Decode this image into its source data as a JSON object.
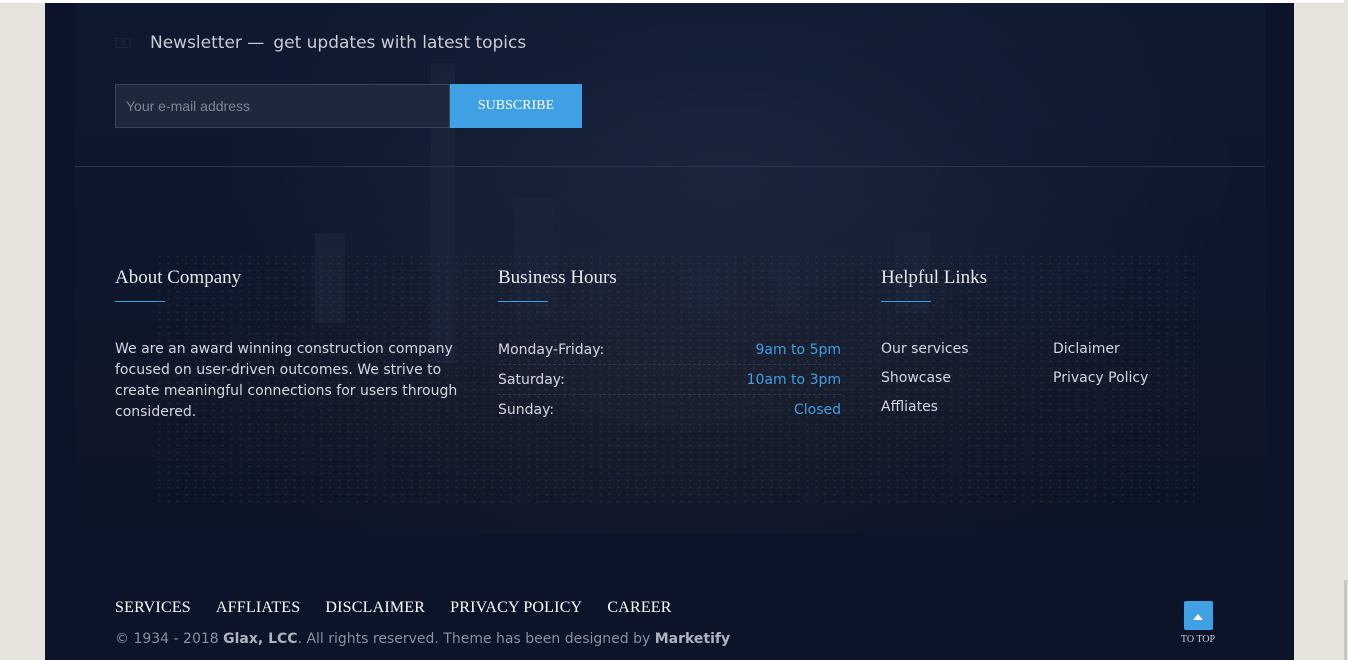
{
  "newsletter": {
    "title": "Newsletter —",
    "subtitle": "get updates with latest topics",
    "icon": "book-icon",
    "email_placeholder": "Your e-mail address",
    "subscribe_label": "SUBSCRIBE"
  },
  "about": {
    "title": "About Company",
    "text": "We are an award winning construction company focused on user-driven outcomes. We strive to create meaningful connections for users through considered."
  },
  "hours": {
    "title": "Business Hours",
    "rows": [
      {
        "day": "Monday-Friday:",
        "time": "9am to 5pm"
      },
      {
        "day": "Saturday:",
        "time": "10am to 3pm"
      },
      {
        "day": "Sunday:",
        "time": "Closed"
      }
    ]
  },
  "links": {
    "title": "Helpful Links",
    "col1": [
      "Our services",
      "Showcase",
      "Affliates"
    ],
    "col2": [
      "Diclaimer",
      "Privacy Policy"
    ]
  },
  "bottom_nav": [
    "SERVICES",
    "AFFLIATES",
    "DISCLAIMER",
    "PRIVACY POLICY",
    "CAREER"
  ],
  "copyright": {
    "prefix": "© 1934 - 2018 ",
    "company": "Glax, LCC",
    "middle": ". All rights reserved. Theme has been designed by ",
    "designer": "Marketify"
  },
  "to_top": {
    "label": "TO TOP",
    "icon": "arrow-up-icon"
  },
  "colors": {
    "accent": "#3fa0e3",
    "footer_bg": "#0b1429",
    "page_bg": "#e6e3dc"
  }
}
